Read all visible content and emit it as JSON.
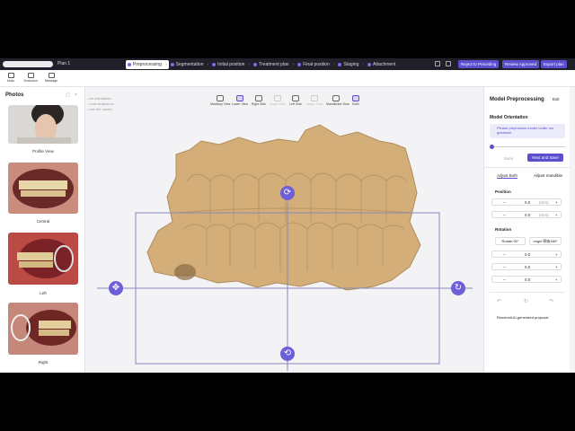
{
  "topbar": {
    "plan": "Plan 1",
    "steps": [
      {
        "label": "Preprocessing",
        "active": true
      },
      {
        "label": "Segmentation"
      },
      {
        "label": "Initial position"
      },
      {
        "label": "Treatment plan"
      },
      {
        "label": "Final position"
      },
      {
        "label": "Staging"
      },
      {
        "label": "Attachment"
      }
    ],
    "buttons": {
      "reject": "Reject to Preceding",
      "approve": "Review Approved",
      "export": "Export plan"
    },
    "accent": "#5b4fd0"
  },
  "toolbar": {
    "items": [
      {
        "label": "Undo"
      },
      {
        "label": "Occlusion"
      },
      {
        "label": "Message"
      }
    ]
  },
  "photos": {
    "title": "Photos",
    "items": [
      {
        "caption": "Profile View"
      },
      {
        "caption": "Central"
      },
      {
        "caption": "Left"
      },
      {
        "caption": "Right"
      }
    ]
  },
  "viewport": {
    "hint": [
      "...ed orientation",
      "...ouse buttons to",
      "...ove the model."
    ],
    "views": [
      {
        "label": "Maxillary View"
      },
      {
        "label": "Lower View"
      },
      {
        "label": "Right Side"
      },
      {
        "label": "Upper View"
      },
      {
        "label": "Left Side"
      },
      {
        "label": "Larger View"
      },
      {
        "label": "Mandibular View"
      },
      {
        "label": "Both"
      }
    ]
  },
  "panel": {
    "title": "Model Preprocessing",
    "exit": "Exit",
    "orientation": {
      "title": "Model Orientation",
      "note": "Please preprocess model under our guidance.",
      "back": "Back",
      "next": "Next and Save"
    },
    "tabs": {
      "both": "Adjust Both",
      "mandible": "Adjust mandible"
    },
    "position": {
      "title": "Position",
      "unit": "(mm)",
      "values": [
        "0.0",
        "0.0"
      ]
    },
    "rotation": {
      "title": "Rotation",
      "rotate": "Rotate 90°",
      "origin": "origin 原始180°",
      "values": [
        "0.0",
        "0.0",
        "0.0"
      ]
    },
    "ai": "Resubmit AI-generated proposal"
  }
}
